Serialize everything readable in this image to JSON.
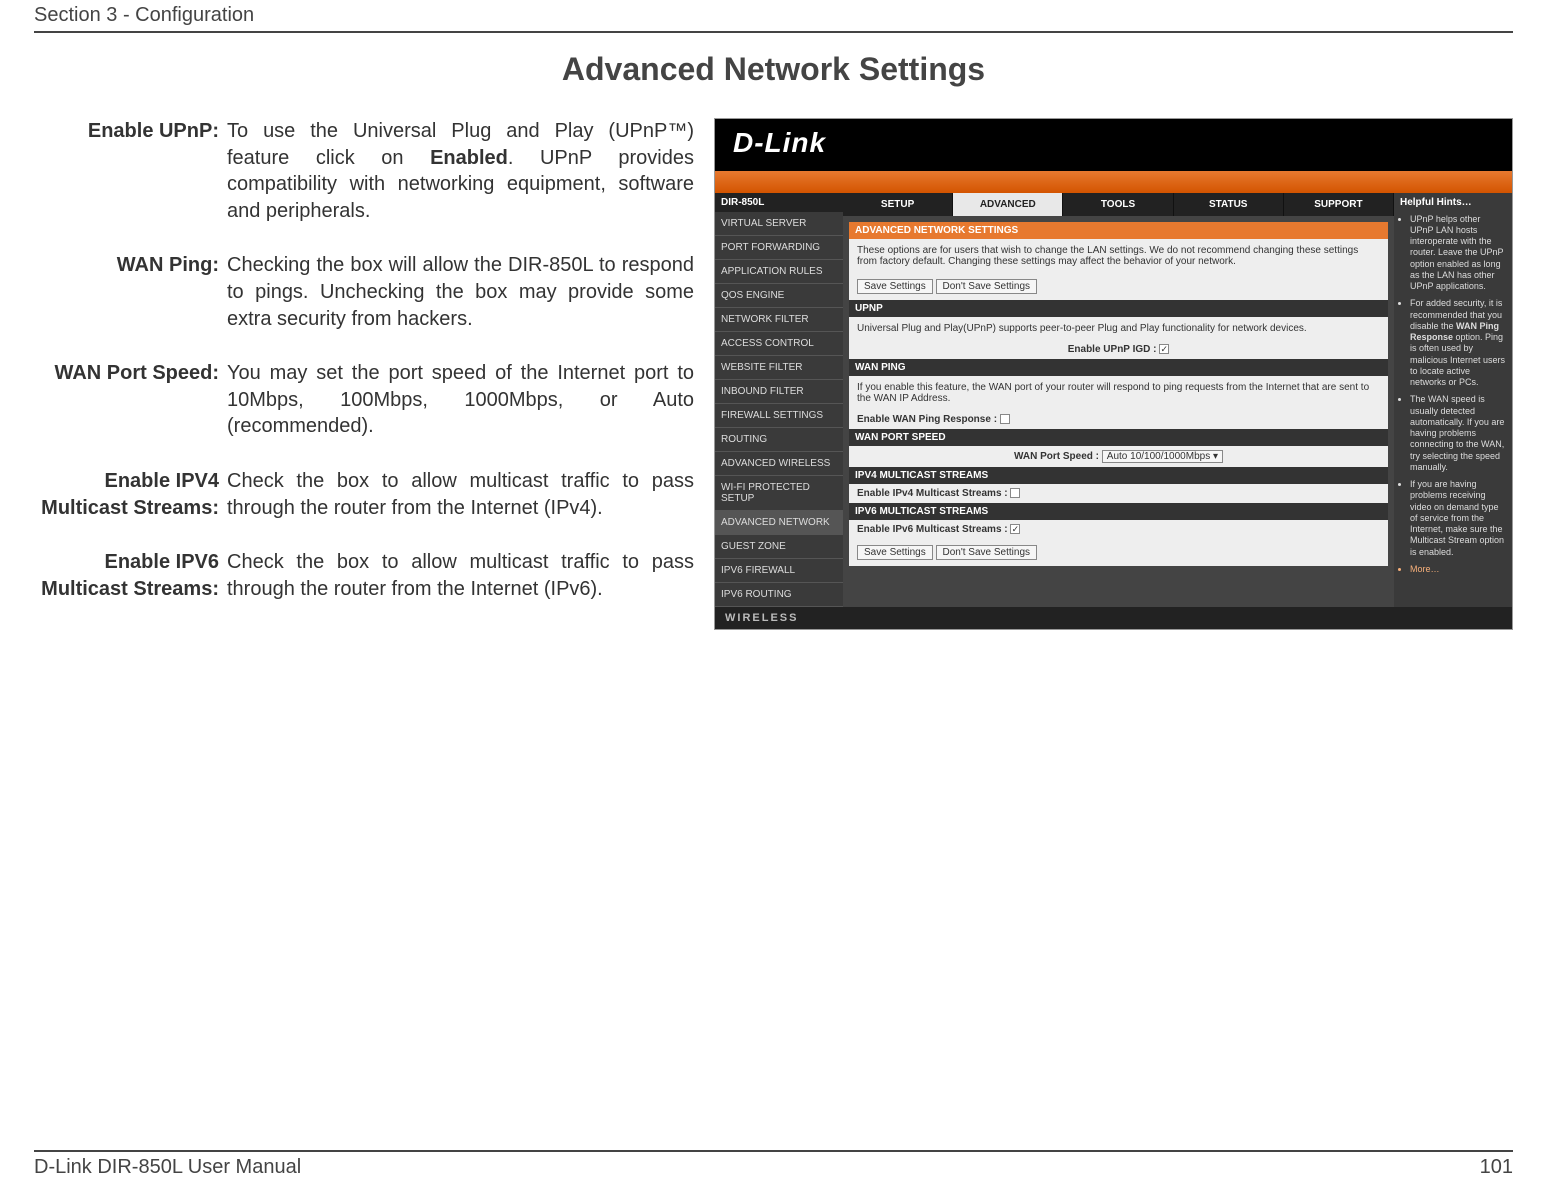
{
  "header": {
    "section": "Section 3 - Configuration"
  },
  "title": "Advanced Network Settings",
  "defs": [
    {
      "label": "Enable UPnP:",
      "desc_parts": [
        "To use the Universal Plug and Play (UPnP™) feature click on ",
        "Enabled",
        ". UPnP provides compatibility with networking equipment, software and peripherals."
      ]
    },
    {
      "label": "WAN Ping:",
      "desc": "Checking the box will allow the DIR-850L to respond to pings. Unchecking the box may provide some extra security from hackers."
    },
    {
      "label": "WAN Port Speed:",
      "desc": "You may set the port speed of the Internet port to 10Mbps, 100Mbps, 1000Mbps, or Auto (recommended)."
    },
    {
      "label": "Enable IPV4 Multicast Streams:",
      "desc": "Check the box to allow multicast traffic to pass through the router from the Internet (IPv4)."
    },
    {
      "label": "Enable IPV6 Multicast Streams:",
      "desc": "Check the box to allow multicast traffic to pass through the router from the Internet (IPv6)."
    }
  ],
  "footer": {
    "manual": "D-Link DIR-850L User Manual",
    "page": "101"
  },
  "figure": {
    "brand": "D-Link",
    "model": "DIR-850L",
    "tabs": [
      "SETUP",
      "ADVANCED",
      "TOOLS",
      "STATUS",
      "SUPPORT"
    ],
    "active_tab": "ADVANCED",
    "sidebar": [
      "VIRTUAL SERVER",
      "PORT FORWARDING",
      "APPLICATION RULES",
      "QOS ENGINE",
      "NETWORK FILTER",
      "ACCESS CONTROL",
      "WEBSITE FILTER",
      "INBOUND FILTER",
      "FIREWALL SETTINGS",
      "ROUTING",
      "ADVANCED WIRELESS",
      "WI-FI PROTECTED SETUP",
      "ADVANCED NETWORK",
      "GUEST ZONE",
      "IPV6 FIREWALL",
      "IPV6 ROUTING"
    ],
    "sidebar_active": "ADVANCED NETWORK",
    "panel": {
      "heading": "ADVANCED NETWORK SETTINGS",
      "intro": "These options are for users that wish to change the LAN settings. We do not recommend changing these settings from factory default. Changing these settings may affect the behavior of your network.",
      "buttons": [
        "Save Settings",
        "Don't Save Settings"
      ],
      "upnp": {
        "bar": "UPNP",
        "text": "Universal Plug and Play(UPnP) supports peer-to-peer Plug and Play functionality for network devices.",
        "field": "Enable UPnP IGD :",
        "checked": true
      },
      "wanping": {
        "bar": "WAN PING",
        "text": "If you enable this feature, the WAN port of your router will respond to ping requests from the Internet that are sent to the WAN IP Address.",
        "field": "Enable WAN Ping Response :",
        "checked": false
      },
      "wanport": {
        "bar": "WAN PORT SPEED",
        "field": "WAN Port Speed :",
        "value": "Auto 10/100/1000Mbps"
      },
      "ipv4m": {
        "bar": "IPV4 MULTICAST STREAMS",
        "field": "Enable IPv4 Multicast Streams :",
        "checked": false
      },
      "ipv6m": {
        "bar": "IPV6 MULTICAST STREAMS",
        "field": "Enable IPv6 Multicast Streams :",
        "checked": true
      }
    },
    "support": {
      "heading": "Helpful Hints…",
      "hints": [
        {
          "pre": "UPnP helps other UPnP LAN hosts interoperate with the router. Leave the UPnP option enabled as long as the LAN has other UPnP applications."
        },
        {
          "pre": "For added security, it is recommended that you disable the ",
          "strong": "WAN Ping Response",
          "post": " option. Ping is often used by malicious Internet users to locate active networks or PCs."
        },
        {
          "pre": "The WAN speed is usually detected automatically. If you are having problems connecting to the WAN, try selecting the speed manually."
        },
        {
          "pre": "If you are having problems receiving video on demand type of service from the Internet, make sure the Multicast Stream option is enabled."
        }
      ],
      "more": "More…"
    },
    "wireless_footer": "WIRELESS"
  }
}
